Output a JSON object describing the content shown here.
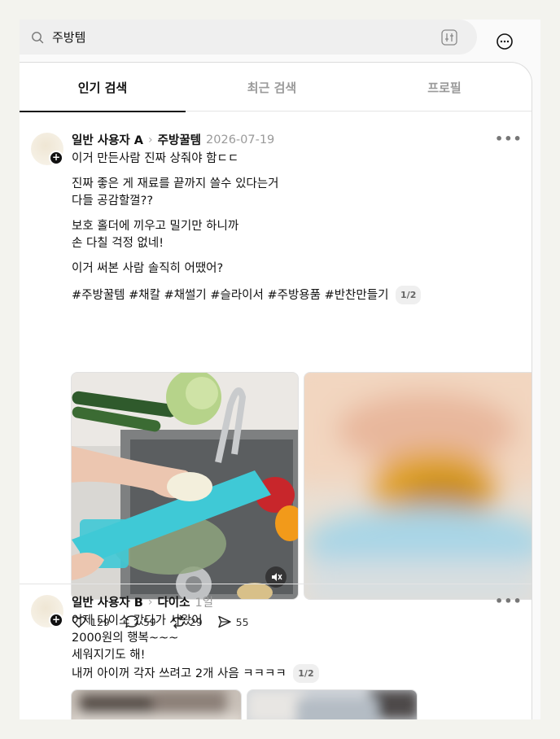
{
  "search": {
    "query": "주방템"
  },
  "tabs": [
    {
      "label": "인기 검색"
    },
    {
      "label": "최근 검색"
    },
    {
      "label": "프로필"
    }
  ],
  "posts": [
    {
      "author": "일반 사용자 A",
      "topic": "주방꿀템",
      "time": "2026-07-19",
      "paragraphs": [
        [
          "이거 만든사람 진짜 상줘야 함ㄷㄷ"
        ],
        [
          "진짜 좋은 게 재료를 끝까지 쓸수 있다는거",
          "다들 공감할껄??"
        ],
        [
          "보호 홀더에 끼우고 밀기만 하니까",
          "손 다칠 걱정 없네!"
        ],
        [
          "이거 써본 사람 솔직히 어땠어?"
        ]
      ],
      "hashtags": "#주방꿀템 #채칼 #채썰기 #슬라이서 #주방용품 #반찬만들기",
      "media_counter": "1/2",
      "likes": "129",
      "comments": "59",
      "reposts": "29",
      "shares": "55"
    },
    {
      "author": "일반 사용자 B",
      "topic": "다이소",
      "time": "1일",
      "lines": [
        "어제 다이소 갔다가 사왔어",
        "2000원의 행복~~~",
        "세워지기도 해!",
        "내꺼 아이꺼 각자 쓰려고 2개 사음 ㅋㅋㅋㅋ"
      ],
      "media_counter": "1/2"
    }
  ],
  "colors": {
    "accent": "#111111",
    "muted": "#9a9a9a",
    "slicer": "#3fc9d6"
  },
  "icons": [
    "search-icon",
    "filter-icon",
    "more-circle-icon",
    "more-dots-icon",
    "plus-icon",
    "heart-icon",
    "comment-icon",
    "repost-icon",
    "share-icon",
    "mute-icon"
  ]
}
